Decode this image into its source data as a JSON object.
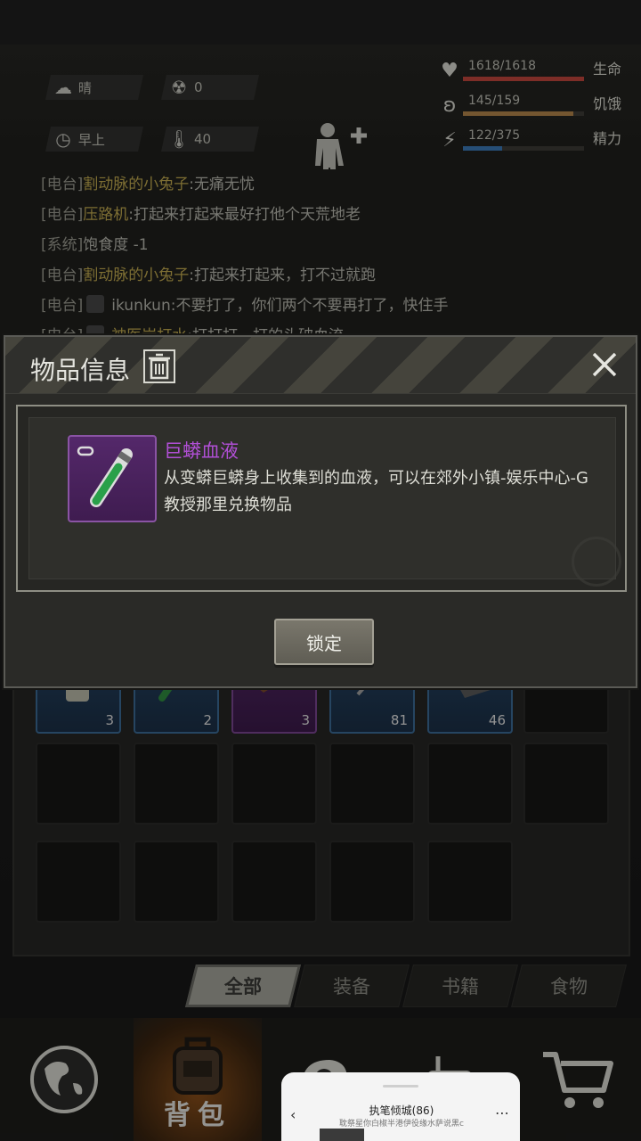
{
  "status": {
    "weather": {
      "icon": "cloud-sun-icon",
      "label": "晴"
    },
    "radiation": {
      "icon": "radiation-icon",
      "value": "0"
    },
    "time": {
      "icon": "clock-icon",
      "label": "早上"
    },
    "temperature": {
      "icon": "thermometer-icon",
      "value": "40"
    },
    "bars": [
      {
        "icon": "heart-pulse-icon",
        "value": "1618/1618",
        "label": "生命",
        "fraction": 1.0,
        "color": "#c0463c"
      },
      {
        "icon": "stomach-icon",
        "value": "145/159",
        "label": "饥饿",
        "fraction": 0.912,
        "color": "#b3844a"
      },
      {
        "icon": "brain-icon",
        "value": "122/375",
        "label": "精力",
        "fraction": 0.325,
        "color": "#3b78b5"
      }
    ]
  },
  "log": [
    {
      "tag": "[电台]",
      "who": "割动脉的小兔子",
      "text": ":无痛无忧",
      "avatar": false
    },
    {
      "tag": "[电台]",
      "who": "压路机",
      "text": ":打起来打起来最好打他个天荒地老",
      "avatar": false
    },
    {
      "tag": "[系统]",
      "who": "",
      "text": "饱食度 -1",
      "avatar": false
    },
    {
      "tag": "[电台]",
      "who": "割动脉的小兔子",
      "text": ":打起来打起来，打不过就跑",
      "avatar": false
    },
    {
      "tag": "[电台]",
      "who": "ikunkun",
      "text": ":不要打了，你们两个不要再打了，快住手",
      "avatar": true
    },
    {
      "tag": "[电台]",
      "who": "神医岩打水",
      "text": ":打打打，打的头破血流",
      "avatar": true
    }
  ],
  "inventory": {
    "row1": [
      {
        "rarity": "blue",
        "qty": "3",
        "icon": "medicine-bottle-icon"
      },
      {
        "rarity": "blue",
        "qty": "2",
        "icon": "test-tube-icon"
      },
      {
        "rarity": "purple",
        "qty": "3",
        "icon": "meat-icon"
      },
      {
        "rarity": "blue",
        "qty": "81",
        "icon": "syringe-icon"
      },
      {
        "rarity": "blue",
        "qty": "46",
        "icon": "cloth-icon"
      },
      {
        "rarity": "empty",
        "qty": "",
        "icon": ""
      }
    ]
  },
  "tabs": [
    {
      "label": "全部",
      "active": true
    },
    {
      "label": "装备",
      "active": false
    },
    {
      "label": "书籍",
      "active": false
    },
    {
      "label": "食物",
      "active": false
    }
  ],
  "nav": {
    "items": [
      {
        "icon": "globe-icon",
        "label": ""
      },
      {
        "icon": "backpack-icon",
        "label": "背包",
        "active": true
      },
      {
        "icon": "gear-head-icon",
        "label": ""
      },
      {
        "icon": "radio-icon",
        "label": ""
      },
      {
        "icon": "cart-icon",
        "label": ""
      }
    ]
  },
  "dialog": {
    "title": "物品信息",
    "item_name": "巨蟒血液",
    "item_desc": "从变蟒巨蟒身上收集到的血液，可以在郊外小镇-娱乐中心-G教授那里兑换物品",
    "lock_label": "锁定"
  },
  "popup": {
    "title": "执笔倾城(86)",
    "subtitle": "耽祭星你白椒半港伊役缘水萨说黑c"
  }
}
